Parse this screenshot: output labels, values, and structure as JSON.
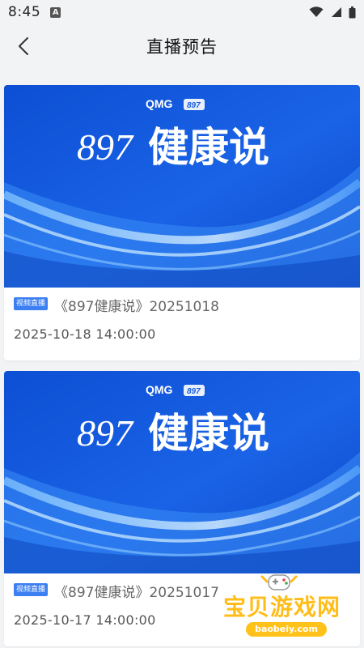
{
  "status_bar": {
    "time": "8:45",
    "badge_letter": "A",
    "icons": [
      "wifi-icon",
      "signal-icon",
      "battery-icon"
    ]
  },
  "nav": {
    "title": "直播预告",
    "back_icon": "chevron-left-icon"
  },
  "banner": {
    "brand": "QMG",
    "channel_badge": "897",
    "headline_number": "897",
    "headline_text": "健康说"
  },
  "items": [
    {
      "badge": "视频直播",
      "title": "《897健康说》20251018",
      "time": "2025-10-18 14:00:00"
    },
    {
      "badge": "视频直播",
      "title": "《897健康说》20251017",
      "time": "2025-10-17 14:00:00"
    }
  ],
  "watermark": {
    "text": "宝贝游戏网",
    "url": "baobeiy.com"
  },
  "colors": {
    "accent": "#3b7ff2",
    "banner_blue": "#1656d6",
    "watermark_yellow": "#ffbd1a"
  }
}
